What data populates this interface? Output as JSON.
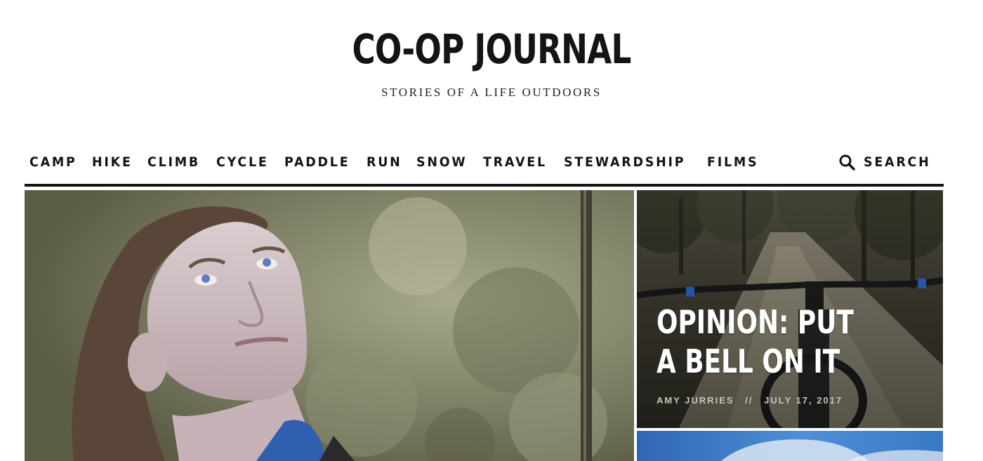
{
  "site": {
    "title": "CO-OP JOURNAL",
    "tagline": "STORIES OF A LIFE OUTDOORS"
  },
  "nav": {
    "items": [
      {
        "label": "CAMP"
      },
      {
        "label": "HIKE"
      },
      {
        "label": "CLIMB"
      },
      {
        "label": "CYCLE"
      },
      {
        "label": "PADDLE"
      },
      {
        "label": "RUN"
      },
      {
        "label": "SNOW"
      },
      {
        "label": "TRAVEL"
      },
      {
        "label": "STEWARDSHIP"
      },
      {
        "label": "FILMS"
      }
    ],
    "search_label": "SEARCH",
    "search_icon": "search-icon"
  },
  "features": {
    "main": {
      "image": "woman-looking-up-photo"
    },
    "side_top": {
      "image": "mountain-bike-trail-photo",
      "headline": "OPINION: PUT A BELL ON IT",
      "author": "AMY JURRIES",
      "separator": "//",
      "date": "JULY 17, 2017"
    },
    "side_bottom": {
      "image": "sky-photo"
    }
  },
  "colors": {
    "text": "#141414",
    "background": "#ffffff",
    "headline_overlay": "#ffffff",
    "meta": "#c9c6b6"
  }
}
